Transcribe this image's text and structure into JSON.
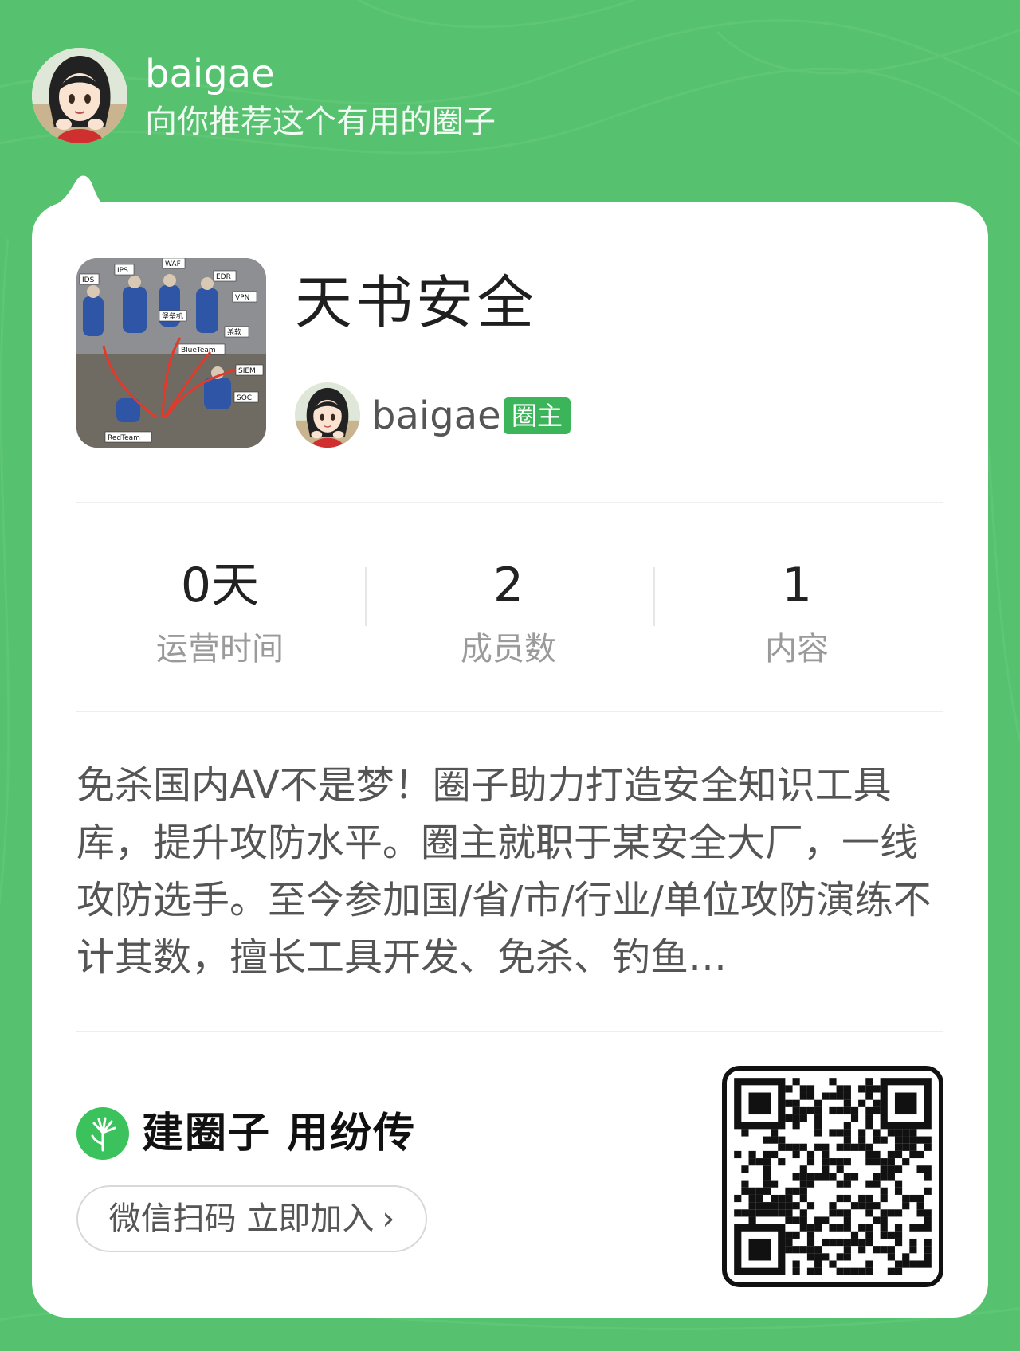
{
  "sharer": {
    "avatar_icon": "anime-girl-avatar-icon",
    "name": "baigae",
    "subtitle": "向你推荐这个有用的圈子"
  },
  "circle": {
    "cover_image": "security-meme-cover",
    "cover_labels": [
      "IDS",
      "IPS",
      "WAF",
      "EDR",
      "VPN",
      "堡垒机",
      "杀软",
      "BlueTeam",
      "SIEM",
      "SOC",
      "RedTeam"
    ],
    "title": "天书安全",
    "owner": {
      "avatar_icon": "anime-girl-avatar-icon",
      "name": "baigae",
      "badge": "圈主"
    }
  },
  "stats": [
    {
      "value": "0天",
      "label": "运营时间"
    },
    {
      "value": "2",
      "label": "成员数"
    },
    {
      "value": "1",
      "label": "内容"
    }
  ],
  "description": "免杀国内AV不是梦！圈子助力打造安全知识工具库，提升攻防水平。圈主就职于某安全大厂，一线攻防选手。至今参加国/省/市/行业/单位攻防演练不计其数，擅长工具开发、免杀、钓鱼…",
  "footer": {
    "brand_icon": "dandelion-logo-icon",
    "slogan": "建圈子 用纷传",
    "join_label": "微信扫码 立即加入",
    "join_arrow": "›",
    "qr_icon": "qr-code-icon"
  },
  "colors": {
    "background": "#56c16e",
    "badge": "#3cb55a",
    "brand": "#3cc25c"
  }
}
